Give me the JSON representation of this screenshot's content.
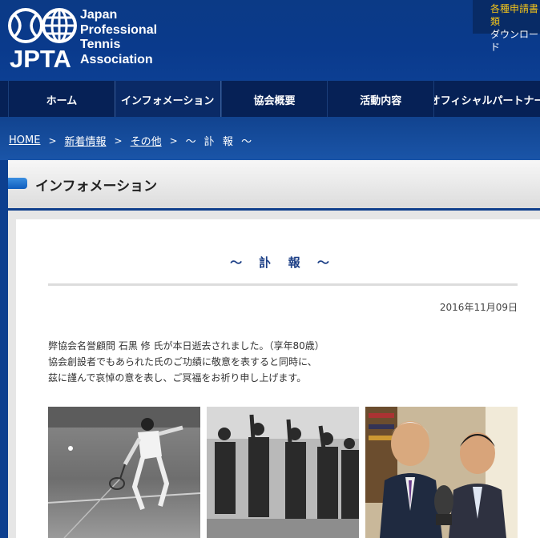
{
  "header": {
    "logo_abbr": "JPTA",
    "logo_name": [
      "Japan",
      "Professional",
      "Tennis",
      "Association"
    ],
    "download_line1": "各種申請書類",
    "download_line2": "ダウンロード"
  },
  "nav": {
    "items": [
      {
        "label": "ホーム"
      },
      {
        "label": "インフォメーション"
      },
      {
        "label": "協会概要"
      },
      {
        "label": "活動内容"
      },
      {
        "label": "オフィシャルパートナー"
      }
    ]
  },
  "breadcrumb": {
    "home": "HOME",
    "news": "新着情報",
    "other": "その他",
    "current": "～ 訃 報 ～",
    "separator": ">"
  },
  "section": {
    "title": "インフォメーション"
  },
  "article": {
    "title": "～ 訃 報 ～",
    "date": "2016年11月09日",
    "body": [
      "弊協会名誉顧問 石黒 修 氏が本日逝去されました。（享年80歳）",
      "協会創設者でもあられた氏のご功績に敬意を表すると同時に、",
      "茲に謹んで哀悼の意を表し、ご冥福をお祈り申し上げます。"
    ]
  },
  "colors": {
    "brand_blue": "#0b3a86",
    "nav_dark": "#062156",
    "accent_yellow": "#f2c319",
    "title_blue": "#1c3f86"
  }
}
